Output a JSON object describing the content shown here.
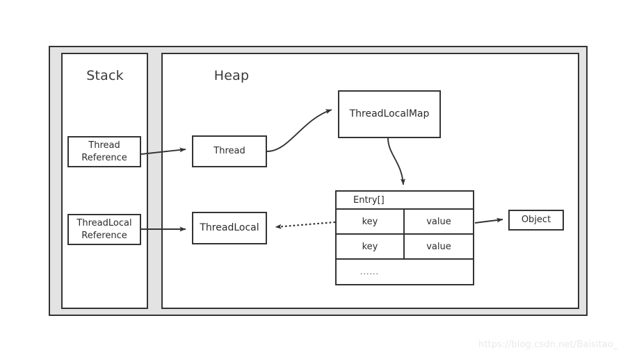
{
  "diagram": {
    "regions": [
      {
        "id": "stack",
        "title": "Stack"
      },
      {
        "id": "heap",
        "title": "Heap"
      }
    ],
    "nodes": [
      {
        "id": "thread-reference",
        "label": "Thread\nReference",
        "region": "stack"
      },
      {
        "id": "threadlocal-reference",
        "label": "ThreadLocal\nReference",
        "region": "stack"
      },
      {
        "id": "thread",
        "label": "Thread",
        "region": "heap"
      },
      {
        "id": "threadlocalmap",
        "label": "ThreadLocalMap",
        "region": "heap"
      },
      {
        "id": "threadlocal",
        "label": "ThreadLocal",
        "region": "heap"
      },
      {
        "id": "object",
        "label": "Object",
        "region": "heap"
      }
    ],
    "entry_table": {
      "header": "Entry[]",
      "columns": [
        "key",
        "value"
      ],
      "rows": [
        {
          "key": "key",
          "value": "value"
        },
        {
          "key": "key",
          "value": "value"
        }
      ],
      "ellipsis": "......"
    },
    "edges": [
      {
        "from": "thread-reference",
        "to": "thread",
        "style": "solid"
      },
      {
        "from": "thread",
        "to": "threadlocalmap",
        "style": "solid-curved"
      },
      {
        "from": "threadlocalmap",
        "to": "entry-table",
        "style": "solid-curved"
      },
      {
        "from": "threadlocal-reference",
        "to": "threadlocal",
        "style": "solid"
      },
      {
        "from": "entry-key",
        "to": "threadlocal",
        "style": "dotted"
      },
      {
        "from": "entry-value",
        "to": "object",
        "style": "solid"
      }
    ],
    "colors": {
      "stroke": "#333333",
      "panel_background": "#ffffff",
      "frame_background": "#e3e3e3",
      "text": "#2b2b2b",
      "watermark": "#e9e9e9"
    }
  },
  "watermark": {
    "text": "https://blog.csdn.net/Baisitao_"
  }
}
